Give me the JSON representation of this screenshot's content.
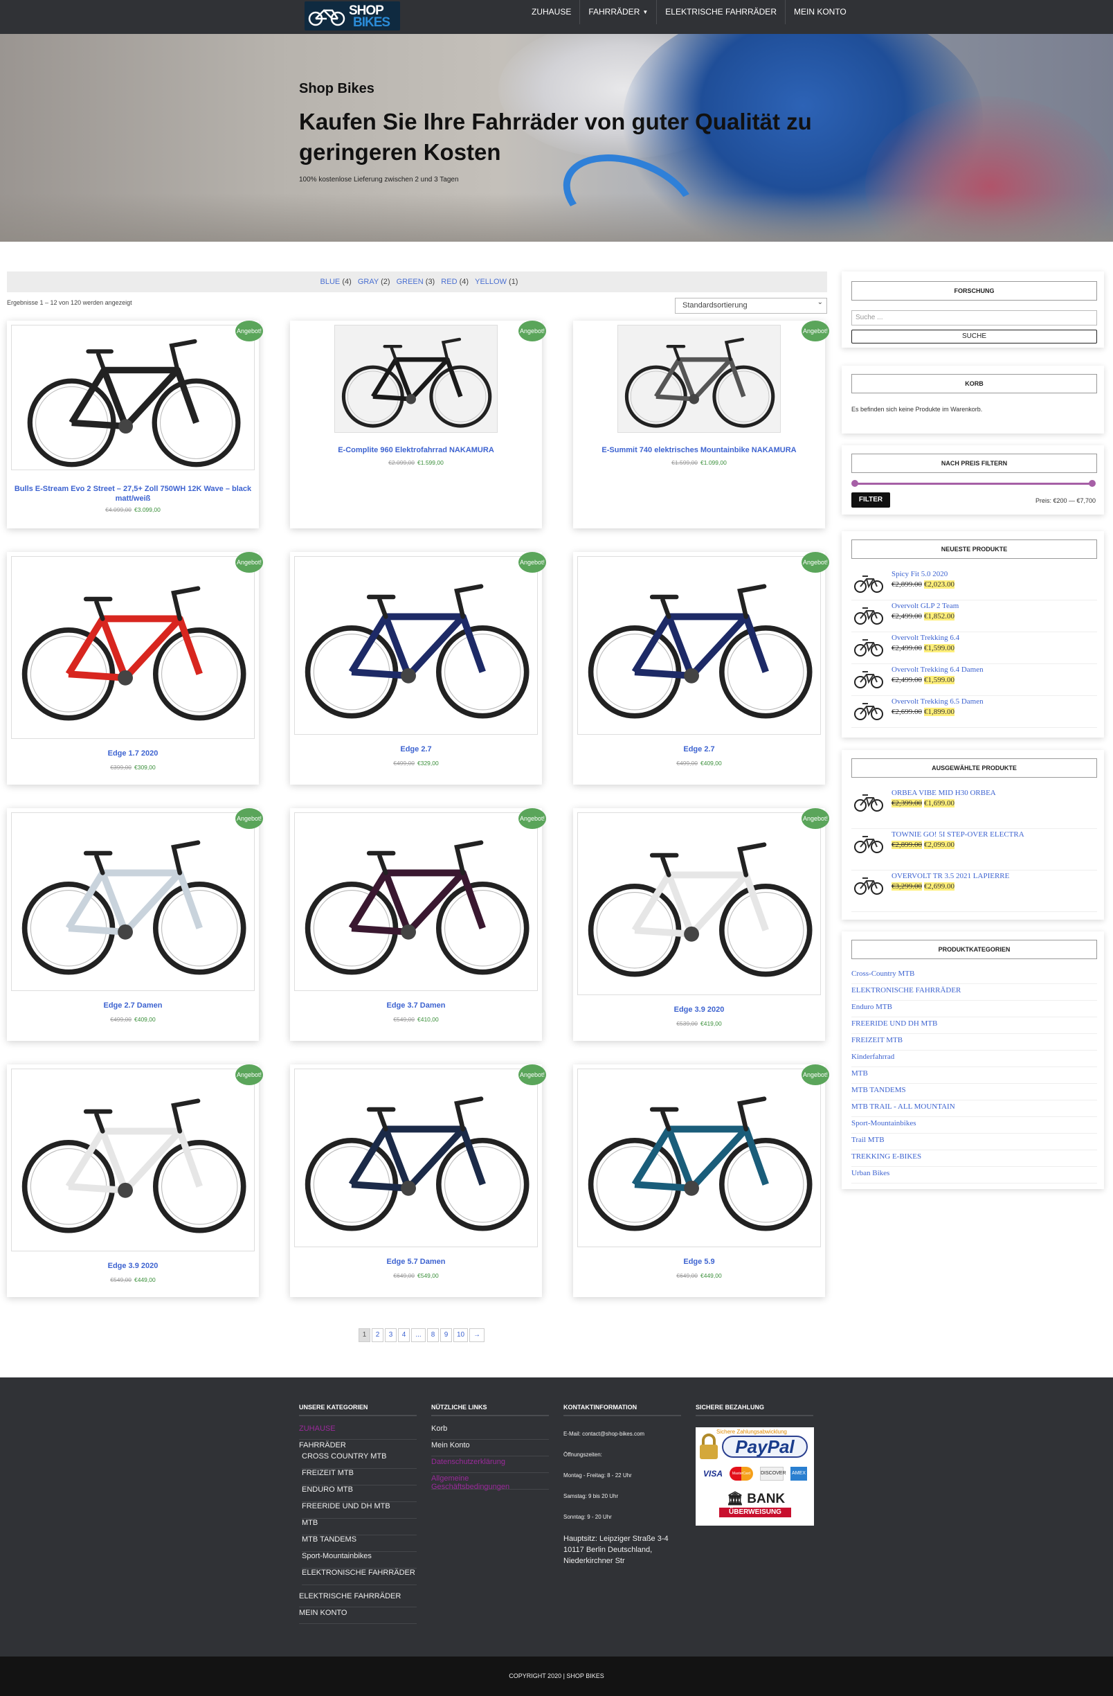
{
  "logo": {
    "line1": "SHOP",
    "line2": "BIKES"
  },
  "nav": {
    "items": [
      {
        "label": "ZUHAUSE"
      },
      {
        "label": "FAHRRÄDER",
        "has_dropdown": true
      },
      {
        "label": "ELEKTRISCHE FAHRRÄDER"
      },
      {
        "label": "MEIN KONTO"
      }
    ]
  },
  "hero": {
    "title": "Shop Bikes",
    "headline": "Kaufen Sie Ihre Fahrräder von guter Qualität zu geringeren Kosten",
    "subtitle": "100% kostenlose Lieferung zwischen 2 und 3 Tagen"
  },
  "color_filter": [
    {
      "name": "BLUE",
      "count": "(4)"
    },
    {
      "name": "GRAY",
      "count": "(2)"
    },
    {
      "name": "GREEN",
      "count": "(3)"
    },
    {
      "name": "RED",
      "count": "(4)"
    },
    {
      "name": "YELLOW",
      "count": "(1)"
    }
  ],
  "results_text": "Ergebnisse 1 – 12 von 120 werden angezeigt",
  "sort": {
    "selected": "Standardsortierung"
  },
  "sale_badge": "Angebot!",
  "products": [
    {
      "name": "Bulls E-Stream Evo 2 Street – 27,5+ Zoll 750WH 12K Wave – black matt/weiß",
      "old_price": "€4.099,00",
      "price": "€3.099,00",
      "frame_color": "#222"
    },
    {
      "name": "E-Complite 960 Elektrofahrrad NAKAMURA",
      "old_price": "€2.099,00",
      "price": "€1.599,00",
      "frame_color": "#1a1a1a"
    },
    {
      "name": "E-Summit 740 elektrisches Mountainbike NAKAMURA",
      "old_price": "€1.599,00",
      "price": "€1.099,00",
      "frame_color": "#555"
    },
    {
      "name": "Edge 1.7 2020",
      "old_price": "€399,00",
      "price": "€309,00",
      "frame_color": "#d8261f"
    },
    {
      "name": "Edge 2.7",
      "old_price": "€499,00",
      "price": "€329,00",
      "frame_color": "#1d2a66"
    },
    {
      "name": "Edge 2.7",
      "old_price": "€499,00",
      "price": "€409,00",
      "frame_color": "#1d2a66"
    },
    {
      "name": "Edge 2.7 Damen",
      "old_price": "€499,00",
      "price": "€409,00",
      "frame_color": "#c9d3dc"
    },
    {
      "name": "Edge 3.7 Damen",
      "old_price": "€549,00",
      "price": "€410,00",
      "frame_color": "#3a1830"
    },
    {
      "name": "Edge 3.9 2020",
      "old_price": "€539,00",
      "price": "€419,00",
      "frame_color": "#e6e6e6"
    },
    {
      "name": "Edge 3.9 2020",
      "old_price": "€549,00",
      "price": "€449,00",
      "frame_color": "#e6e6e6"
    },
    {
      "name": "Edge 5.7 Damen",
      "old_price": "€649,00",
      "price": "€549,00",
      "frame_color": "#1b2a48"
    },
    {
      "name": "Edge 5.9",
      "old_price": "€649,00",
      "price": "€449,00",
      "frame_color": "#1a5d7a"
    }
  ],
  "pagination": [
    "1",
    "2",
    "3",
    "4",
    "...",
    "8",
    "9",
    "10",
    "→"
  ],
  "sidebar": {
    "search": {
      "title": "FORSCHUNG",
      "placeholder": "Suche ...",
      "button": "SUCHE"
    },
    "cart": {
      "title": "KORB",
      "empty_text": "Es befinden sich keine Produkte im Warenkorb."
    },
    "price_filter": {
      "title": "NACH PREIS FILTERN",
      "button": "FILTER",
      "label": "Preis: €200 — €7,700"
    },
    "newest": {
      "title": "NEUESTE PRODUKTE",
      "items": [
        {
          "name": "Spicy Fit 5.0 2020",
          "old_price": "€2,899.00",
          "price": "€2,023.00"
        },
        {
          "name": "Overvolt GLP 2 Team",
          "old_price": "€2,499.00",
          "price": "€1,852.00"
        },
        {
          "name": "Overvolt Trekking 6.4",
          "old_price": "€2,499.00",
          "price": "€1,599.00"
        },
        {
          "name": "Overvolt Trekking 6.4 Damen",
          "old_price": "€2,499.00",
          "price": "€1,599.00"
        },
        {
          "name": "Overvolt Trekking 6.5 Damen",
          "old_price": "€2,699.00",
          "price": "€1,899.00"
        }
      ]
    },
    "featured": {
      "title": "AUSGEWÄHLTE PRODUKTE",
      "items": [
        {
          "name": "ORBEA VIBE MID H30 ORBEA",
          "old_price": "€2,399.00",
          "price": "€1,699.00"
        },
        {
          "name": "TOWNIE GO! 5I STEP-OVER ELECTRA",
          "old_price": "€2,899.00",
          "price": "€2,099.00"
        },
        {
          "name": "OVERVOLT TR 3.5 2021 LAPIERRE",
          "old_price": "€3,299.00",
          "price": "€2,699.00"
        }
      ]
    },
    "categories": {
      "title": "PRODUKTKATEGORIEN",
      "items": [
        "Cross-Country MTB",
        "ELEKTRONISCHE FAHRRÄDER",
        "Enduro MTB",
        "FREERIDE UND DH MTB",
        "FREIZEIT MTB",
        "Kinderfahrrad",
        "MTB",
        "MTB TANDEMS",
        "MTB TRAIL - ALL MOUNTAIN",
        "Sport-Mountainbikes",
        "Trail MTB",
        "TREKKING E-BIKES",
        "Urban Bikes"
      ]
    }
  },
  "footer": {
    "categories": {
      "title": "UNSERE KATEGORIEN",
      "first": "ZUHAUSE",
      "parent": "FAHRRÄDER",
      "sub": [
        "CROSS COUNTRY MTB",
        "FREIZEIT MTB",
        "ENDURO MTB",
        "FREERIDE UND DH MTB",
        "MTB",
        "MTB TANDEMS",
        "Sport-Mountainbikes",
        "ELEKTRONISCHE FAHRRÄDER"
      ],
      "after": [
        "ELEKTRISCHE FAHRRÄDER",
        "MEIN KONTO"
      ]
    },
    "links": {
      "title": "NÜTZLICHE LINKS",
      "items": [
        "Korb",
        "Mein Konto",
        "Datenschutzerklärung",
        "Allgemeine Geschäftsbedingungen"
      ]
    },
    "contact": {
      "title": "KONTAKTINFORMATION",
      "email": "E-Mail: contact@shop-bikes.com",
      "hours_title": "Öffnungszeiten:",
      "hours": [
        "Montag - Freitag: 8 - 22 Uhr",
        "Samstag: 9 bis 20 Uhr",
        "Sonntag: 9 - 20 Uhr"
      ],
      "address": "Hauptsitz: Leipziger Straße 3-4 10117 Berlin Deutschland, Niederkirchner Str"
    },
    "payment": {
      "title": "SICHERE BEZAHLUNG",
      "badge_top": "Sichere Zahlungsabwicklung",
      "paypal": "PayPal",
      "cards": [
        "VISA",
        "MasterCard",
        "DISCOVER",
        "AMEX"
      ],
      "bank_line1": "BANK",
      "bank_line2": "ÜBERWEISUNG"
    }
  },
  "copyright": "COPYRIGHT 2020 | SHOP BIKES"
}
